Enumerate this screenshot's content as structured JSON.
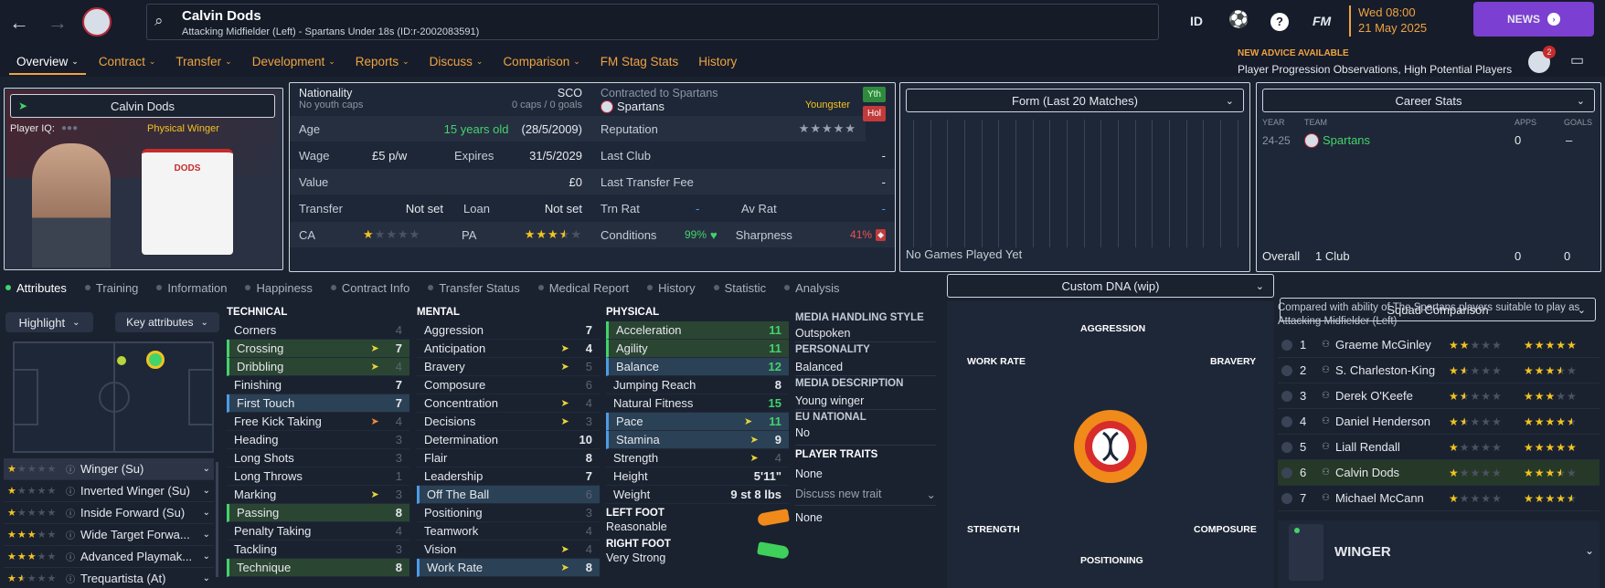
{
  "header": {
    "player_name": "Calvin Dods",
    "player_subtitle": "Attacking Midfielder (Left) - Spartans Under 18s (ID:r-2002083591)",
    "id_label": "ID",
    "fm_label": "FM",
    "date_line1": "Wed 08:00",
    "date_line2": "21 May 2025",
    "news_label": "NEWS"
  },
  "nav": {
    "items": [
      "Overview",
      "Contract",
      "Transfer",
      "Development",
      "Reports",
      "Discuss",
      "Comparison",
      "FM Stag Stats",
      "History"
    ],
    "advice_title": "NEW ADVICE AVAILABLE",
    "advice_text": "Player Progression Observations, High Potential Players",
    "notification_count": "2"
  },
  "profile": {
    "name": "Calvin Dods",
    "player_iq_label": "Player IQ:",
    "role_tag": "Physical Winger",
    "shirt_name": "DODS"
  },
  "info": {
    "nationality_label": "Nationality",
    "nationality_value": "SCO",
    "youth_caps": "No youth caps",
    "caps_goals": "0 caps / 0 goals",
    "age_label": "Age",
    "age_value": "15 years old",
    "dob": "(28/5/2009)",
    "wage_label": "Wage",
    "wage_value": "£5 p/w",
    "expires_label": "Expires",
    "expires_value": "31/5/2029",
    "value_label": "Value",
    "value_value": "£0",
    "transfer_label": "Transfer",
    "transfer_value": "Not set",
    "loan_label": "Loan",
    "loan_value": "Not set",
    "ca_label": "CA",
    "ca_stars": 1,
    "pa_label": "PA",
    "pa_stars": 3.5
  },
  "contract": {
    "contracted_label": "Contracted to Spartans",
    "club": "Spartans",
    "status": "Youngster",
    "badge_yth": "Yth",
    "badge_hol": "Hol",
    "reputation_label": "Reputation",
    "last_club_label": "Last Club",
    "last_club_value": "-",
    "last_fee_label": "Last Transfer Fee",
    "last_fee_value": "-",
    "trn_rat_label": "Trn Rat",
    "trn_rat_value": "-",
    "av_rat_label": "Av Rat",
    "av_rat_value": "-",
    "conditions_label": "Conditions",
    "conditions_value": "99%",
    "sharpness_label": "Sharpness",
    "sharpness_value": "41%"
  },
  "form": {
    "title": "Form (Last 20 Matches)",
    "empty": "No Games Played Yet"
  },
  "career": {
    "title": "Career Stats",
    "headers": [
      "YEAR",
      "TEAM",
      "APPS",
      "GOALS"
    ],
    "rows": [
      {
        "year": "24-25",
        "team": "Spartans",
        "apps": "0",
        "goals": "–"
      }
    ],
    "total_label": "Overall",
    "total_clubs": "1 Club",
    "total_apps": "0",
    "total_goals": "0"
  },
  "tabs": [
    "Attributes",
    "Training",
    "Information",
    "Happiness",
    "Contract Info",
    "Transfer Status",
    "Medical Report",
    "History",
    "Statistic",
    "Analysis"
  ],
  "attributes": {
    "highlight_label": "Highlight",
    "key_attr_label": "Key attributes",
    "roles": [
      {
        "name": "Winger (Su)",
        "stars": 1
      },
      {
        "name": "Inverted Winger (Su)",
        "stars": 1
      },
      {
        "name": "Inside Forward (Su)",
        "stars": 1
      },
      {
        "name": "Wide Target Forwa...",
        "stars": 3
      },
      {
        "name": "Advanced Playmak...",
        "stars": 3
      },
      {
        "name": "Trequartista (At)",
        "stars": 1.5
      }
    ],
    "technical_header": "TECHNICAL",
    "technical": [
      {
        "name": "Corners",
        "value": "4"
      },
      {
        "name": "Crossing",
        "value": "7"
      },
      {
        "name": "Dribbling",
        "value": "4"
      },
      {
        "name": "Finishing",
        "value": "7"
      },
      {
        "name": "First Touch",
        "value": "7"
      },
      {
        "name": "Free Kick Taking",
        "value": "4"
      },
      {
        "name": "Heading",
        "value": "3"
      },
      {
        "name": "Long Shots",
        "value": "3"
      },
      {
        "name": "Long Throws",
        "value": "1"
      },
      {
        "name": "Marking",
        "value": "3"
      },
      {
        "name": "Passing",
        "value": "8"
      },
      {
        "name": "Penalty Taking",
        "value": "4"
      },
      {
        "name": "Tackling",
        "value": "3"
      },
      {
        "name": "Technique",
        "value": "8"
      }
    ],
    "mental_header": "MENTAL",
    "mental": [
      {
        "name": "Aggression",
        "value": "7"
      },
      {
        "name": "Anticipation",
        "value": "4"
      },
      {
        "name": "Bravery",
        "value": "5"
      },
      {
        "name": "Composure",
        "value": "6"
      },
      {
        "name": "Concentration",
        "value": "4"
      },
      {
        "name": "Decisions",
        "value": "3"
      },
      {
        "name": "Determination",
        "value": "10"
      },
      {
        "name": "Flair",
        "value": "8"
      },
      {
        "name": "Leadership",
        "value": "7"
      },
      {
        "name": "Off The Ball",
        "value": "6"
      },
      {
        "name": "Positioning",
        "value": "3"
      },
      {
        "name": "Teamwork",
        "value": "4"
      },
      {
        "name": "Vision",
        "value": "4"
      },
      {
        "name": "Work Rate",
        "value": "8"
      }
    ],
    "physical_header": "PHYSICAL",
    "physical": [
      {
        "name": "Acceleration",
        "value": "11"
      },
      {
        "name": "Agility",
        "value": "11"
      },
      {
        "name": "Balance",
        "value": "12"
      },
      {
        "name": "Jumping Reach",
        "value": "8"
      },
      {
        "name": "Natural Fitness",
        "value": "15"
      },
      {
        "name": "Pace",
        "value": "11"
      },
      {
        "name": "Stamina",
        "value": "9"
      },
      {
        "name": "Strength",
        "value": "4"
      }
    ],
    "height_label": "Height",
    "height_value": "5'11\"",
    "weight_label": "Weight",
    "weight_value": "9 st 8 lbs",
    "left_foot_label": "LEFT FOOT",
    "left_foot_value": "Reasonable",
    "right_foot_label": "RIGHT FOOT",
    "right_foot_value": "Very Strong"
  },
  "media": {
    "style_header": "MEDIA HANDLING STYLE",
    "style_value": "Outspoken",
    "personality_header": "PERSONALITY",
    "personality_value": "Balanced",
    "description_header": "MEDIA DESCRIPTION",
    "description_value": "Young winger",
    "eu_header": "EU NATIONAL",
    "eu_value": "No",
    "traits_header": "PLAYER TRAITS",
    "traits_value": "None",
    "discuss_label": "Discuss new trait",
    "discuss_value": "None"
  },
  "dna": {
    "title": "Custom DNA (wip)",
    "labels": {
      "top": "AGGRESSION",
      "left": "WORK RATE",
      "right": "BRAVERY",
      "bottom_left": "STRENGTH",
      "bottom_right": "COMPOSURE",
      "bottom": "POSITIONING"
    }
  },
  "squad": {
    "title": "Squad Comparison",
    "description": "Compared with ability of The Spartans players suitable to play as Attacking Midfielder (Left)",
    "players": [
      {
        "rank": "1",
        "name": "Graeme McGinley",
        "ca": 2,
        "pa": 5
      },
      {
        "rank": "2",
        "name": "S. Charleston-King",
        "ca": 1.5,
        "pa": 3.5
      },
      {
        "rank": "3",
        "name": "Derek O'Keefe",
        "ca": 1.5,
        "pa": 3
      },
      {
        "rank": "4",
        "name": "Daniel Henderson",
        "ca": 1.5,
        "pa": 4.5
      },
      {
        "rank": "5",
        "name": "Liall Rendall",
        "ca": 1,
        "pa": 5
      },
      {
        "rank": "6",
        "name": "Calvin Dods",
        "ca": 1,
        "pa": 3.5
      },
      {
        "rank": "7",
        "name": "Michael McCann",
        "ca": 1,
        "pa": 4.5
      }
    ],
    "position_label": "WINGER"
  },
  "colors": {
    "accent": "#f0a340",
    "green": "#43d36b",
    "news": "#7b3fd1",
    "star": "#f2c320"
  }
}
